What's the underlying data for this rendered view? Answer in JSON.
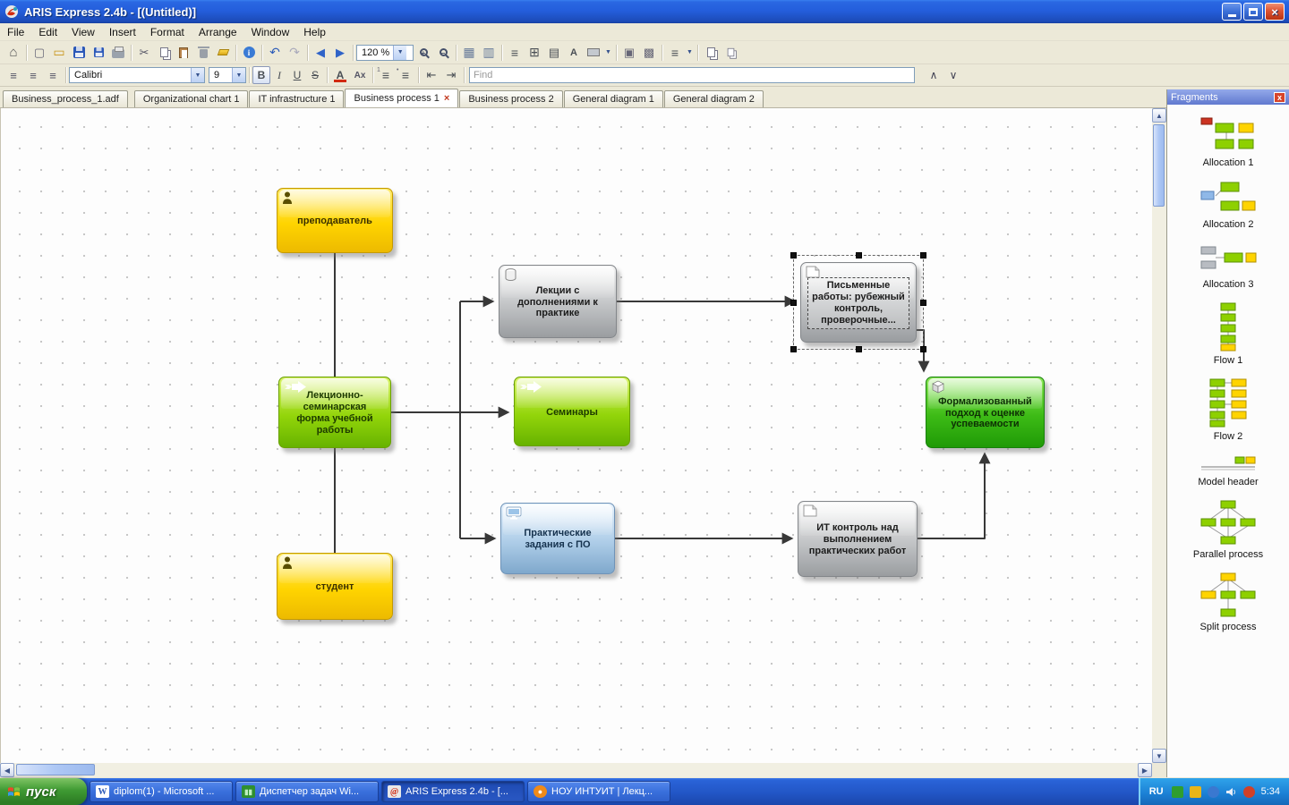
{
  "titlebar": {
    "title": "ARIS Express 2.4b - [(Untitled)]"
  },
  "menubar": {
    "items": [
      "File",
      "Edit",
      "View",
      "Insert",
      "Format",
      "Arrange",
      "Window",
      "Help"
    ]
  },
  "toolbar": {
    "zoom": "120 %",
    "font": "Calibri",
    "font_size": "9",
    "bold": "B",
    "italic": "I",
    "underline": "U",
    "strike": "S",
    "font_color_label": "A",
    "find_placeholder": "Find"
  },
  "tabbar": {
    "file_tab": "Business_process_1.adf",
    "close_glyph": "×",
    "tabs": [
      {
        "label": "Organizational chart 1"
      },
      {
        "label": "IT infrastructure 1"
      },
      {
        "label": "Business process 1",
        "active": true
      },
      {
        "label": "Business process 2"
      },
      {
        "label": "General diagram 1"
      },
      {
        "label": "General diagram 2"
      }
    ]
  },
  "canvas": {
    "nodes": [
      {
        "label": "преподаватель",
        "icon": "person",
        "color": "yellow"
      },
      {
        "label": "Лекции с дополнениями к практике",
        "icon": "database",
        "color": "gray"
      },
      {
        "label": "Письменные работы: рубежный контроль, проверочные...",
        "icon": "document",
        "color": "gray",
        "selected": true
      },
      {
        "label": "Лекционно-семинарская форма учебной работы",
        "icon": "process-arrow",
        "color": "green"
      },
      {
        "label": "Семинары",
        "icon": "process-arrow",
        "color": "green"
      },
      {
        "label": "Формализованный подход к оценке успеваемости",
        "icon": "cube",
        "color": "dark-green"
      },
      {
        "label": "Практические задания с ПО",
        "icon": "monitor",
        "color": "blue"
      },
      {
        "label": "ИТ контроль над выполнением практических работ",
        "icon": "document",
        "color": "gray"
      },
      {
        "label": "студент",
        "icon": "person",
        "color": "yellow"
      }
    ]
  },
  "fragments": {
    "title": "Fragments",
    "items": [
      {
        "label": "Allocation 1"
      },
      {
        "label": "Allocation 2"
      },
      {
        "label": "Allocation 3"
      },
      {
        "label": "Flow 1"
      },
      {
        "label": "Flow 2"
      },
      {
        "label": "Model header"
      },
      {
        "label": "Parallel process"
      },
      {
        "label": "Split process"
      }
    ]
  },
  "taskbar": {
    "start": "пуск",
    "buttons": [
      {
        "label": "diplom(1) - Microsoft ..."
      },
      {
        "label": "Диспетчер задач Wi..."
      },
      {
        "label": "ARIS Express 2.4b - [...",
        "active": true
      },
      {
        "label": "НОУ ИНТУИТ | Лекц..."
      }
    ],
    "tray": {
      "language": "RU",
      "time": "5:34"
    }
  }
}
